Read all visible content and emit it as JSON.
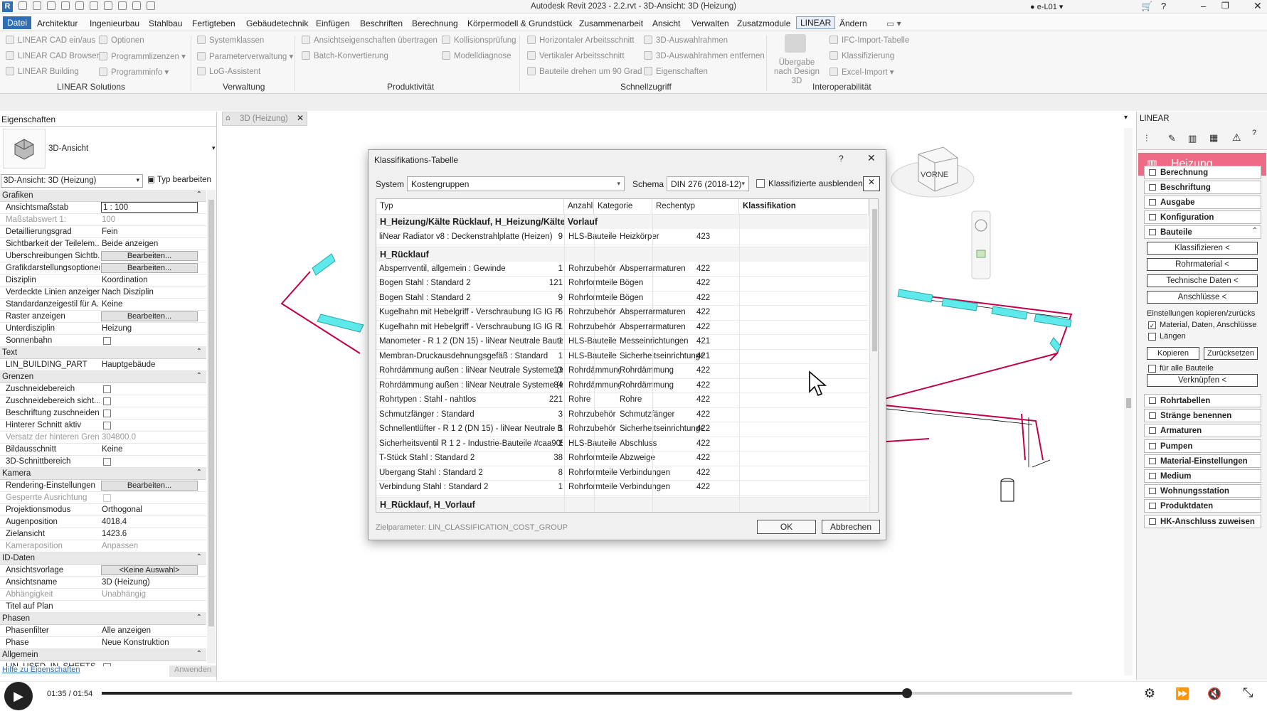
{
  "window": {
    "title": "Autodesk Revit 2023 - 2.2.rvt - 3D-Ansicht: 3D (Heizung)",
    "user": "e-L01"
  },
  "menubar": [
    "Datei",
    "Architektur",
    "Ingenieurbau",
    "Stahlbau",
    "Fertigteben",
    "Gebäudetechnik",
    "Einfügen",
    "Beschriften",
    "Berechnung",
    "Körpermodell & Grundstück",
    "Zusammenarbeit",
    "Ansicht",
    "Verwalten",
    "Zusatzmodule",
    "LINEAR",
    "Ändern"
  ],
  "ribbon": {
    "groups": [
      "LINEAR Solutions",
      "Verwaltung",
      "Produktivität",
      "Schnellzugriff",
      "Interoperabilität"
    ],
    "solutions": [
      "LINEAR CAD ein/aus",
      "LINEAR CAD Browser",
      "LINEAR Building",
      "Optionen",
      "Programmlizenzen",
      "Programminfo"
    ],
    "verwaltung": [
      "Systemklassen",
      "Parameterverwaltung",
      "LoG-Assistent"
    ],
    "produktivitaet": [
      "Ansichtseigenschaften übertragen",
      "Batch-Konvertierung",
      "Kollisionsprüfung",
      "Modelldiagnose"
    ],
    "schnellzugriff": [
      "Horizontaler Arbeitsschnitt",
      "Vertikaler Arbeitsschnitt",
      "Bauteile drehen um 90 Grad",
      "3D-Auswahlrahmen",
      "3D-Auswahlrahmen entfernen",
      "Eigenschaften"
    ],
    "interop": [
      "Übergabe nach Design 3D",
      "IFC-Import-Tabelle",
      "Klassifizierung",
      "Excel-Import"
    ]
  },
  "properties": {
    "title": "Eigenschaften",
    "type_name": "3D-Ansicht",
    "selector": "3D-Ansicht: 3D (Heizung)",
    "edit_type": "Typ bearbeiten",
    "help_link": "Hilfe zu Eigenschaften",
    "apply": "Anwenden",
    "edit_label": "Bearbeiten..."
  },
  "prop_rows": [
    {
      "kind": "sect",
      "label": "Grafiken"
    },
    {
      "label": "Ansichtsmaßstab",
      "value": "1 : 100",
      "boxed": true
    },
    {
      "label": "Maßstabswert 1:",
      "value": "100",
      "dim": true
    },
    {
      "label": "Detaillierungsgrad",
      "value": "Fein"
    },
    {
      "label": "Sichtbarkeit der Teilelem...",
      "value": "Beide anzeigen"
    },
    {
      "label": "Überschreibungen Sichtb...",
      "button": true
    },
    {
      "label": "Grafikdarstellungsoptionen",
      "button": true
    },
    {
      "label": "Disziplin",
      "value": "Koordination"
    },
    {
      "label": "Verdeckte Linien anzeigen",
      "value": "Nach Disziplin"
    },
    {
      "label": "Standardanzeigestil für A...",
      "value": "Keine"
    },
    {
      "label": "Raster anzeigen",
      "button": true
    },
    {
      "label": "Unterdisziplin",
      "value": "Heizung"
    },
    {
      "label": "Sonnenbahn",
      "check": true
    },
    {
      "kind": "sect",
      "label": "Text"
    },
    {
      "label": "LIN_BUILDING_PART",
      "value": "Hauptgebäude"
    },
    {
      "kind": "sect",
      "label": "Grenzen"
    },
    {
      "label": "Zuschneidebereich",
      "check": true
    },
    {
      "label": "Zuschneidebereich sicht...",
      "check": true
    },
    {
      "label": "Beschriftung zuschneiden",
      "check": true
    },
    {
      "label": "Hinterer Schnitt aktiv",
      "check": true
    },
    {
      "label": "Versatz der hinteren Grenze",
      "value": "304800.0",
      "dim": true
    },
    {
      "label": "Bildausschnitt",
      "value": "Keine"
    },
    {
      "label": "3D-Schnittbereich",
      "check": true
    },
    {
      "kind": "sect",
      "label": "Kamera"
    },
    {
      "label": "Rendering-Einstellungen",
      "button": true
    },
    {
      "label": "Gesperrte Ausrichtung",
      "check": true,
      "dim": true
    },
    {
      "label": "Projektionsmodus",
      "value": "Orthogonal"
    },
    {
      "label": "Augenposition",
      "value": "4018.4"
    },
    {
      "label": "Zielansicht",
      "value": "1423.6"
    },
    {
      "label": "Kameraposition",
      "value": "Anpassen",
      "dim": true
    },
    {
      "kind": "sect",
      "label": "ID-Daten"
    },
    {
      "label": "Ansichtsvorlage",
      "value": "<Keine Auswahl>",
      "button": true
    },
    {
      "label": "Ansichtsname",
      "value": "3D (Heizung)"
    },
    {
      "label": "Abhängigkeit",
      "value": "Unabhängig",
      "dim": true
    },
    {
      "label": "Titel auf Plan",
      "value": ""
    },
    {
      "kind": "sect",
      "label": "Phasen"
    },
    {
      "label": "Phasenfilter",
      "value": "Alle anzeigen"
    },
    {
      "label": "Phase",
      "value": "Neue Konstruktion"
    },
    {
      "kind": "sect",
      "label": "Allgemein"
    },
    {
      "label": "LIN_USED_IN_SHEETS",
      "check": true
    }
  ],
  "view_tab": "3D (Heizung)",
  "viewcube_label": "VORNE",
  "dialog": {
    "title": "Klassifikations-Tabelle",
    "help": "?",
    "system_label": "System",
    "system_value": "Kostengruppen",
    "schema_label": "Schema",
    "schema_value": "DIN 276 (2018-12)",
    "hide_label": "Klassifizierte ausblenden",
    "columns": [
      "Typ",
      "Anzahl",
      "Kategorie",
      "Rechentyp",
      "Klassifikation"
    ],
    "groups": [
      {
        "title": "H_Heizung/Kälte Rücklauf, H_Heizung/Kälte Vorlauf",
        "rows": [
          [
            "liNear Radiator v8 : Deckenstrahlplatte (Heizen)",
            "9",
            "HLS-Bauteile",
            "Heizkörper",
            "423"
          ]
        ]
      },
      {
        "title": "H_Rücklauf",
        "rows": [
          [
            "Absperrventil, allgemein : Gewinde",
            "1",
            "Rohrzubehör",
            "Absperrarmaturen",
            "422"
          ],
          [
            "Bogen Stahl : Standard 2",
            "121",
            "Rohrformteile",
            "Bögen",
            "422"
          ],
          [
            "Bogen Stahl : Standard 2",
            "9",
            "Rohrformteile",
            "Bögen",
            "422"
          ],
          [
            "Kugelhahn mit Hebelgriff - Verschraubung IG IG R",
            "6",
            "Rohrzubehör",
            "Absperrarmaturen",
            "422"
          ],
          [
            "Kugelhahn mit Hebelgriff - Verschraubung IG IG R",
            "1",
            "Rohrzubehör",
            "Absperrarmaturen",
            "422"
          ],
          [
            "Manometer - R 1 2 (DN 15) - liNear Neutrale Baute",
            "1",
            "HLS-Bauteile",
            "Messeinrichtungen",
            "421"
          ],
          [
            "Membran-Druckausdehnungsgefäß : Standard",
            "1",
            "HLS-Bauteile",
            "Sicherheitseinrichtunge",
            "421"
          ],
          [
            "Rohrdämmung außen : liNear Neutrale Systeme (Is",
            "13",
            "Rohrdämmung",
            "Rohrdämmung",
            "422"
          ],
          [
            "Rohrdämmung außen : liNear Neutrale Systeme (Is",
            "84",
            "Rohrdämmung",
            "Rohrdämmung",
            "422"
          ],
          [
            "Rohrtypen : Stahl - nahtlos",
            "221",
            "Rohre",
            "Rohre",
            "422"
          ],
          [
            "Schmutzfänger : Standard",
            "3",
            "Rohrzubehör",
            "Schmutzfänger",
            "422"
          ],
          [
            "Schnellentlüfter - R 1 2 (DN 15) - liNear Neutrale B",
            "1",
            "Rohrzubehör",
            "Sicherheitseinrichtunge",
            "422"
          ],
          [
            "Sicherheitsventil R 1 2 - Industrie-Bauteile #caa905",
            "1",
            "HLS-Bauteile",
            "Abschluss",
            "422"
          ],
          [
            "T-Stück Stahl : Standard 2",
            "38",
            "Rohrformteile",
            "Abzweige",
            "422"
          ],
          [
            "Übergang Stahl : Standard 2",
            "8",
            "Rohrformteile",
            "Verbindungen",
            "422"
          ],
          [
            "Verbindung Stahl : Standard 2",
            "1",
            "Rohrformteile",
            "Verbindungen",
            "422"
          ]
        ]
      },
      {
        "title": "H_Rücklauf, H_Vorlauf",
        "rows": []
      }
    ],
    "target": "Zielparameter: LIN_CLASSIFICATION_COST_GROUP",
    "ok": "OK",
    "cancel": "Abbrechen"
  },
  "right_panel": {
    "title": "LINEAR",
    "header": "Heizung",
    "header_color": "#ef6b85",
    "buttons": [
      "Berechnung",
      "Beschriftung",
      "Ausgabe",
      "Konfiguration",
      "Bauteile"
    ],
    "sub_buttons": [
      "Klassifizieren  <",
      "Rohrmaterial  <",
      "Technische Daten  <",
      "Anschlüsse  <"
    ],
    "settings_label": "Einstellungen kopieren/zurücks",
    "check_material": "Material, Daten, Anschlüsse",
    "check_laengen": "Längen",
    "copy": "Kopieren",
    "reset": "Zurücksetzen",
    "all_parts": "für alle Bauteile",
    "link": "Verknüpfen  <",
    "buttons2": [
      "Rohrtabellen",
      "Stränge benennen",
      "Armaturen",
      "Pumpen",
      "Material-Einstellungen",
      "Medium",
      "Wohnungsstation",
      "Produktdaten",
      "HK-Anschluss zuweisen"
    ]
  },
  "player": {
    "time": "01:35 / 01:54",
    "progress": 0.83
  },
  "colors": {
    "accent": "#2f6db5",
    "pipe": "#c0004a",
    "plate": "#5ee9ea"
  }
}
